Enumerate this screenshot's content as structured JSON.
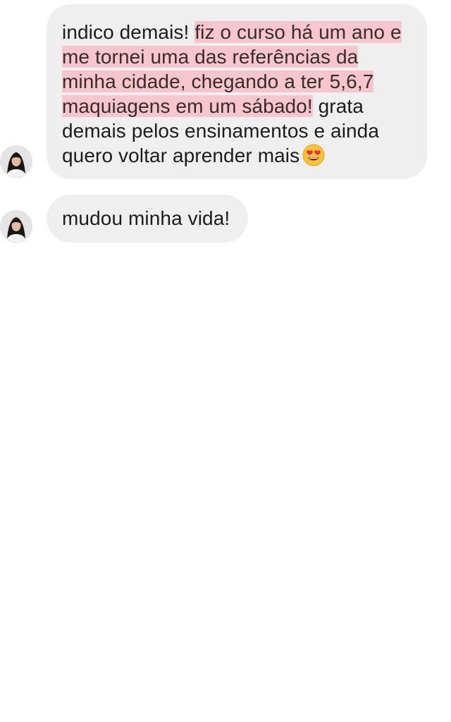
{
  "messages": [
    {
      "text_before": "indico demais!",
      "highlighted": "fiz o curso há um ano e me tornei uma das referências da minha cidade, chegando a ter 5,6,7 maquiagens em um sábado!",
      "text_after": "grata demais pelos ensinamentos e ainda quero voltar aprender mais",
      "emoji": "heart-eyes-emoji",
      "sender_avatar": "avatar-icon"
    },
    {
      "text": "mudou minha vida!",
      "sender_avatar": "avatar-icon"
    }
  ],
  "colors": {
    "bubble": "#efeff0",
    "highlight": "#f6c6cc",
    "text": "#1c1c1e"
  }
}
